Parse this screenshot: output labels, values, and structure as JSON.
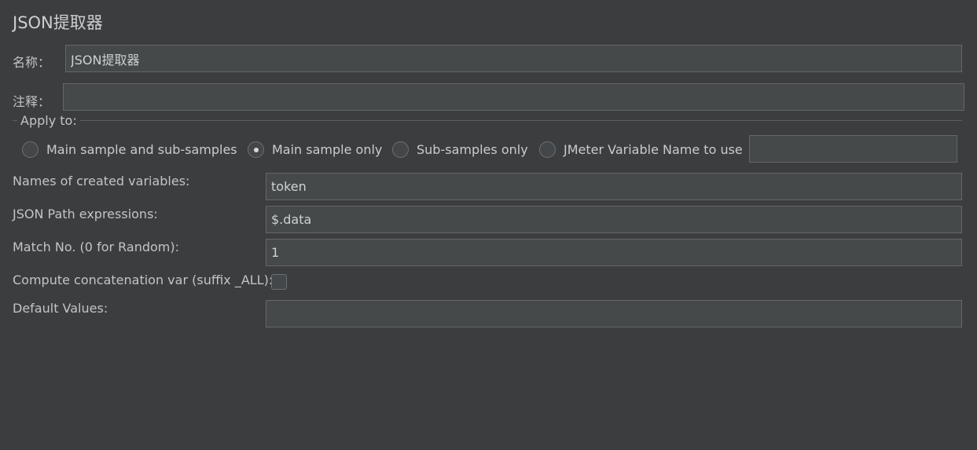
{
  "panel": {
    "title": "JSON提取器"
  },
  "name": {
    "label": "名称：",
    "value": "JSON提取器"
  },
  "comment": {
    "label": "注释：",
    "value": ""
  },
  "apply_to": {
    "title": "Apply to:",
    "options": [
      {
        "label": "Main sample and sub-samples",
        "selected": false
      },
      {
        "label": "Main sample only",
        "selected": true
      },
      {
        "label": "Sub-samples only",
        "selected": false
      },
      {
        "label": "JMeter Variable Name to use",
        "selected": false
      }
    ],
    "variable_name_value": ""
  },
  "fields": {
    "names_of_created_variables": {
      "label": "Names of created variables:",
      "value": "token"
    },
    "json_path_expressions": {
      "label": "JSON Path expressions:",
      "value": "$.data"
    },
    "match_no": {
      "label": "Match No. (0 for Random):",
      "value": "1"
    },
    "compute_concatenation": {
      "label": "Compute concatenation var (suffix _ALL):",
      "checked": false
    },
    "default_values": {
      "label": "Default Values:",
      "value": ""
    }
  }
}
